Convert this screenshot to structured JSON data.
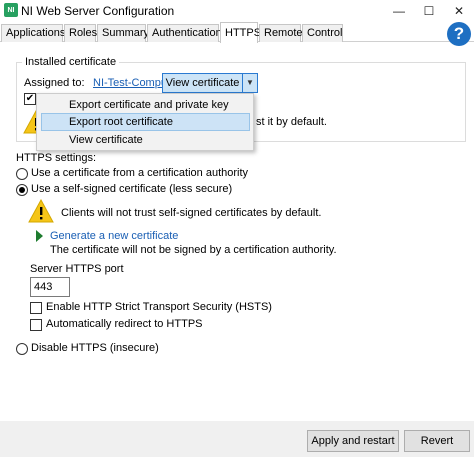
{
  "window": {
    "title": "NI Web Server Configuration",
    "app_icon_text": "NI",
    "minimize_glyph": "—",
    "maximize_glyph": "☐",
    "close_glyph": "✕"
  },
  "tabs": [
    {
      "label": "Applications",
      "active": false
    },
    {
      "label": "Roles",
      "active": false
    },
    {
      "label": "Summary",
      "active": false
    },
    {
      "label": "Authentication",
      "active": false
    },
    {
      "label": "HTTPS",
      "active": true
    },
    {
      "label": "Remote",
      "active": false
    },
    {
      "label": "Control",
      "active": false
    }
  ],
  "help": {
    "label": "?"
  },
  "installed_certificate": {
    "title": "Installed certificate",
    "assigned_to_label": "Assigned to:",
    "assigned_to_value": "NI-Test-Computer",
    "view_button_label": "View certificate",
    "checkbox_checked": true,
    "checkbox_mark": "✔",
    "truncated_warning": "st it by default."
  },
  "dropdown_menu": {
    "items": [
      {
        "label": "Export certificate and private key",
        "hover": false
      },
      {
        "label": "Export root certificate",
        "hover": true
      },
      {
        "label": "View certificate",
        "hover": false
      }
    ]
  },
  "https_settings": {
    "label": "HTTPS settings:",
    "option_ca": "Use a certificate from a certification authority",
    "option_self_signed": "Use a self-signed certificate (less secure)",
    "selected": "self_signed",
    "self_signed_warning": "Clients will not trust self-signed certificates by default.",
    "generate_link": "Generate a new certificate",
    "generate_note": "The certificate will not be signed by a certification authority.",
    "port_label": "Server HTTPS port",
    "port_value": "443",
    "hsts_label": "Enable HTTP Strict Transport Security (HSTS)",
    "hsts_checked": false,
    "redirect_label": "Automatically redirect to HTTPS",
    "redirect_checked": false,
    "option_disable": "Disable HTTPS (insecure)"
  },
  "footer": {
    "apply_label": "Apply and restart",
    "revert_label": "Revert"
  },
  "colors": {
    "accent": "#1e6fc2",
    "link": "#1a5fb4",
    "warning": "#f5c518",
    "selected_button": "#cce4f7",
    "menu_hover": "#cde3f6"
  }
}
